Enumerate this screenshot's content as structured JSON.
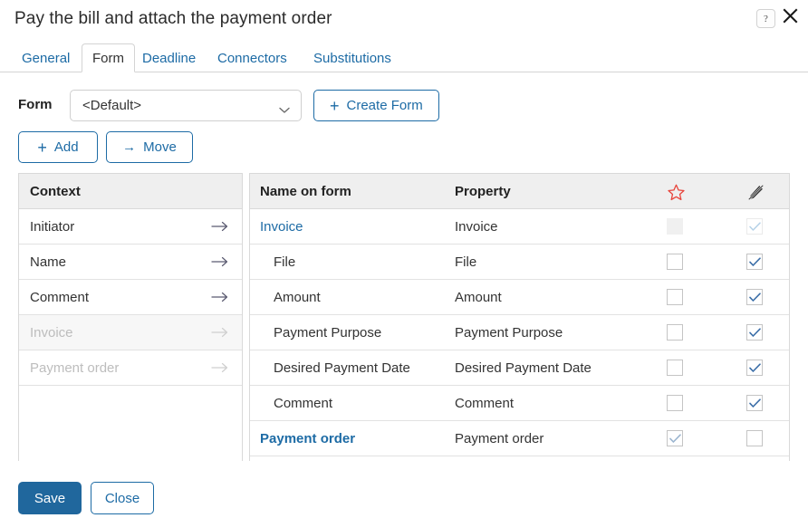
{
  "dialog": {
    "title": "Pay the bill and attach the payment order",
    "help_icon": "question-mark-icon",
    "close_icon": "close-icon"
  },
  "tabs": [
    {
      "label": "General",
      "active": false
    },
    {
      "label": "Form",
      "active": true
    },
    {
      "label": "Deadline",
      "active": false
    },
    {
      "label": "Connectors",
      "active": false
    },
    {
      "label": "Substitutions",
      "active": false
    }
  ],
  "form_row": {
    "label": "Form",
    "select_value": "<Default>",
    "select_placeholder": "<Default>",
    "chevron_icon": "chevron-down-icon",
    "create_form_label": "Create Form",
    "create_form_icon": "plus-icon"
  },
  "actions": {
    "add_label": "Add",
    "add_icon": "plus-icon",
    "move_label": "Move",
    "move_icon": "arrow-right-icon"
  },
  "context_table": {
    "header": "Context",
    "arrow_icon": "arrow-right-icon",
    "rows": [
      {
        "label": "Initiator",
        "disabled": false,
        "alt": false
      },
      {
        "label": "Name",
        "disabled": false,
        "alt": false
      },
      {
        "label": "Comment",
        "disabled": false,
        "alt": false
      },
      {
        "label": "Invoice",
        "disabled": true,
        "alt": true
      },
      {
        "label": "Payment order",
        "disabled": true,
        "alt": false
      }
    ]
  },
  "form_table": {
    "headers": {
      "name_on_form": "Name on form",
      "property": "Property",
      "required_icon": "star-icon",
      "readonly_icon": "pencil-slash-icon"
    },
    "colors": {
      "star": "#e8453c",
      "pencil": "#3d3d3d",
      "link": "#1d6ba5",
      "accent": "#20679d"
    },
    "rows": [
      {
        "name": "Invoice",
        "property": "Invoice",
        "style": "link",
        "indent": false,
        "required": false,
        "required_state": "blank-disabled",
        "readonly": true,
        "readonly_state": "checked-disabled"
      },
      {
        "name": "File",
        "property": "File",
        "style": "plain",
        "indent": true,
        "required": false,
        "required_state": "unchecked",
        "readonly": true,
        "readonly_state": "checked"
      },
      {
        "name": "Amount",
        "property": "Amount",
        "style": "plain",
        "indent": true,
        "required": false,
        "required_state": "unchecked",
        "readonly": true,
        "readonly_state": "checked"
      },
      {
        "name": "Payment Purpose",
        "property": "Payment Purpose",
        "style": "plain",
        "indent": true,
        "required": false,
        "required_state": "unchecked",
        "readonly": true,
        "readonly_state": "checked"
      },
      {
        "name": "Desired Payment Date",
        "property": "Desired Payment Date",
        "style": "plain",
        "indent": true,
        "required": false,
        "required_state": "unchecked",
        "readonly": true,
        "readonly_state": "checked"
      },
      {
        "name": "Comment",
        "property": "Comment",
        "style": "plain",
        "indent": true,
        "required": false,
        "required_state": "unchecked",
        "readonly": true,
        "readonly_state": "checked"
      },
      {
        "name": "Payment order",
        "property": "Payment order",
        "style": "link-bold",
        "indent": false,
        "required": true,
        "required_state": "checked-disabled",
        "readonly": false,
        "readonly_state": "unchecked"
      }
    ]
  },
  "footer": {
    "save_label": "Save",
    "close_label": "Close"
  }
}
